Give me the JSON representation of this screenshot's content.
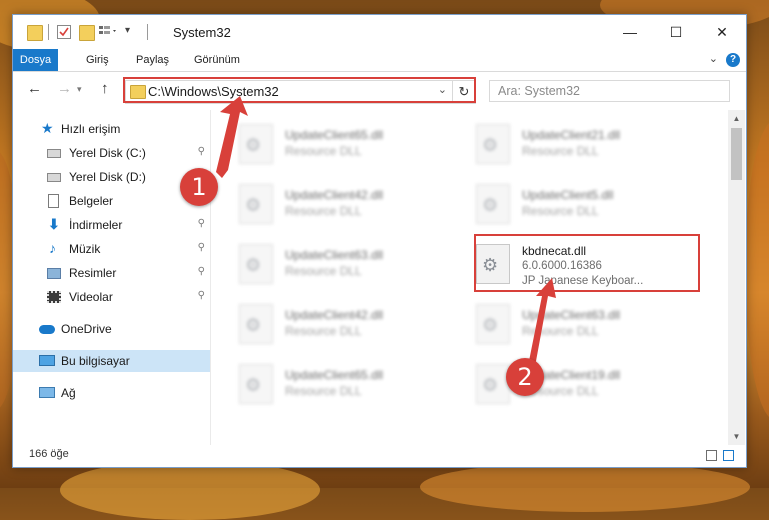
{
  "window": {
    "title": "System32",
    "controls": {
      "minimize": "—",
      "maximize": "☐",
      "close": "✕"
    }
  },
  "ribbon": {
    "tabs": [
      "Dosya",
      "Giriş",
      "Paylaş",
      "Görünüm"
    ],
    "help": "?"
  },
  "navigation": {
    "back": "←",
    "forward": "→",
    "up": "↑",
    "address": "C:\\Windows\\System32",
    "refresh": "↻",
    "search_placeholder": "Ara: System32"
  },
  "sidebar": {
    "items": [
      {
        "label": "Hızlı erişim",
        "icon": "star-icon",
        "pinned": false
      },
      {
        "label": "Yerel Disk (C:)",
        "icon": "drive-icon",
        "pinned": true
      },
      {
        "label": "Yerel Disk (D:)",
        "icon": "drive-icon",
        "pinned": true
      },
      {
        "label": "Belgeler",
        "icon": "documents-icon",
        "pinned": true
      },
      {
        "label": "İndirmeler",
        "icon": "download-icon",
        "pinned": true
      },
      {
        "label": "Müzik",
        "icon": "music-icon",
        "pinned": true
      },
      {
        "label": "Resimler",
        "icon": "pictures-icon",
        "pinned": true
      },
      {
        "label": "Videolar",
        "icon": "videos-icon",
        "pinned": true
      },
      {
        "label": "OneDrive",
        "icon": "cloud-icon",
        "pinned": false
      },
      {
        "label": "Bu bilgisayar",
        "icon": "computer-icon",
        "pinned": false,
        "selected": true
      },
      {
        "label": "Ağ",
        "icon": "network-icon",
        "pinned": false
      }
    ],
    "pin_glyph": "📌"
  },
  "files": {
    "blurred": [
      {
        "name": "UpdateClient65.dll",
        "type": "Resource DLL"
      },
      {
        "name": "UpdateClient21.dll",
        "type": "Resource DLL"
      },
      {
        "name": "UpdateClient42.dll",
        "type": "Resource DLL"
      },
      {
        "name": "UpdateClient5.dll",
        "type": "Resource DLL"
      },
      {
        "name": "UpdateClient63.dll",
        "type": "Resource DLL"
      },
      {
        "name": "UpdateClient42.dll",
        "type": "Resource DLL"
      },
      {
        "name": "UpdateClient63.dll",
        "type": "Resource DLL"
      },
      {
        "name": "UpdateClient65.dll",
        "type": "Resource DLL"
      },
      {
        "name": "UpdateClient19.dll",
        "type": "Resource DLL"
      }
    ],
    "featured": {
      "name": "kbdnecat.dll",
      "version": "6.0.6000.16386",
      "description": "JP Japanese Keyboar..."
    }
  },
  "status": {
    "item_count": "166 öğe"
  },
  "annotations": {
    "step1": "1",
    "step2": "2",
    "color": "#d8403a"
  }
}
